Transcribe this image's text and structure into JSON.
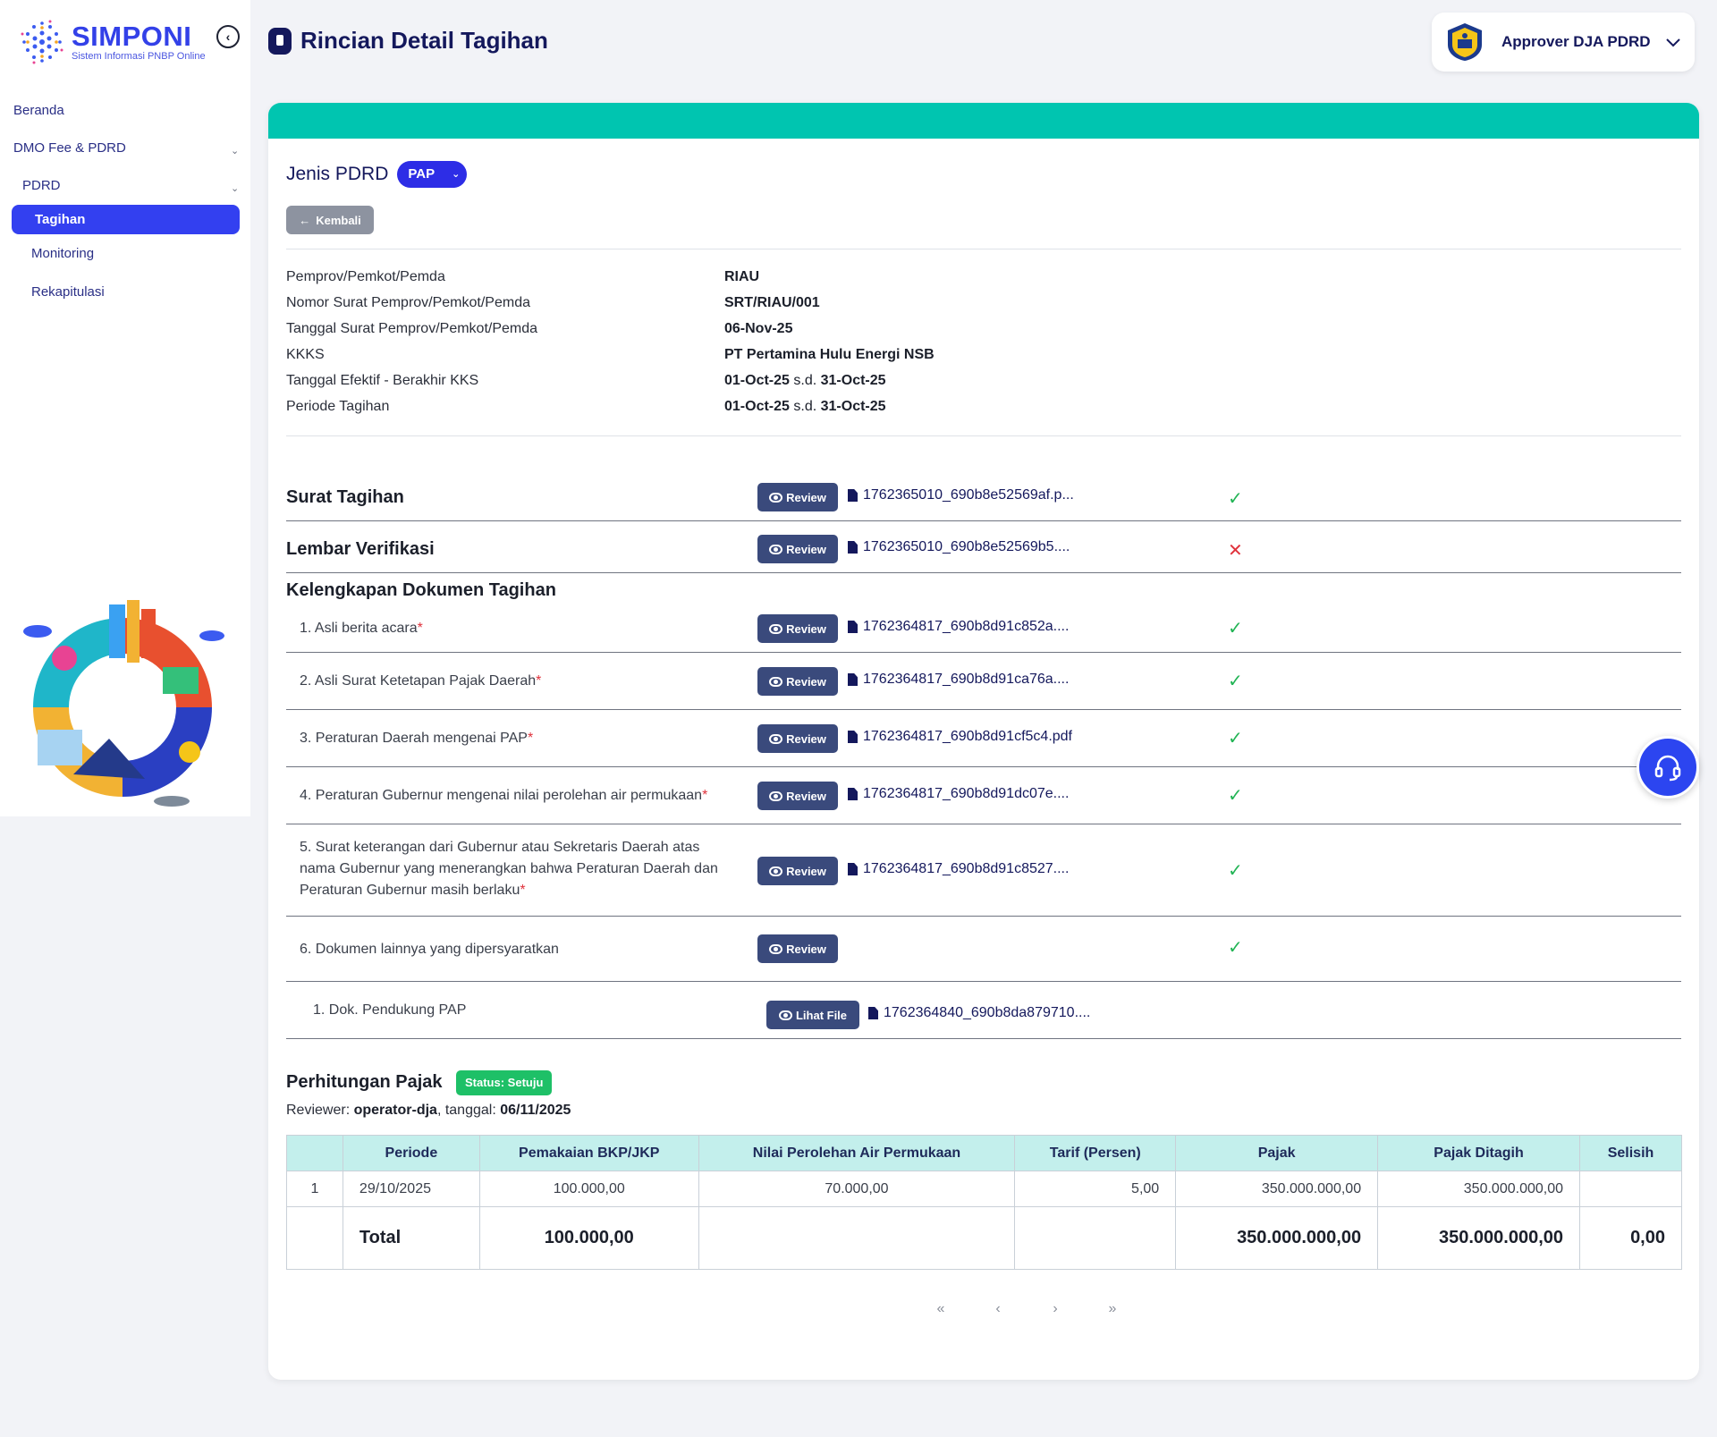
{
  "brand": {
    "title": "SIMPONI",
    "subtitle": "Sistem Informasi PNBP Online",
    "color": "#3341e8"
  },
  "sidebar": {
    "items": [
      {
        "label": "Beranda"
      },
      {
        "label": "DMO Fee & PDRD"
      },
      {
        "label": "PDRD"
      },
      {
        "label": "Tagihan",
        "active": true
      },
      {
        "label": "Monitoring"
      },
      {
        "label": "Rekapitulasi"
      }
    ]
  },
  "header": {
    "title": "Rincian Detail Tagihan",
    "user": "Approver DJA PDRD"
  },
  "card": {
    "accent": "#00c5b0",
    "jenis_label": "Jenis PDRD",
    "jenis_value": "PAP",
    "back_label": "Kembali",
    "info": [
      {
        "label": "Pemprov/Pemkot/Pemda",
        "value": "RIAU"
      },
      {
        "label": "Nomor Surat Pemprov/Pemkot/Pemda",
        "value": "SRT/RIAU/001"
      },
      {
        "label": "Tanggal Surat Pemprov/Pemkot/Pemda",
        "value": "06-Nov-25"
      },
      {
        "label": "KKKS",
        "value": "PT Pertamina Hulu Energi NSB"
      },
      {
        "label": "Tanggal Efektif - Berakhir KKS",
        "from": "01-Oct-25",
        "sep": "s.d.",
        "to": "31-Oct-25"
      },
      {
        "label": "Periode Tagihan",
        "from": "01-Oct-25",
        "sep": "s.d.",
        "to": "31-Oct-25"
      }
    ],
    "review_label": "Review",
    "lihat_label": "Lihat File",
    "surat": {
      "title": "Surat Tagihan",
      "file": "1762365010_690b8e52569af.p...",
      "status": "✓"
    },
    "lembar": {
      "title": "Lembar Verifikasi",
      "file": "1762365010_690b8e52569b5....",
      "status": "✕"
    },
    "kelengkapan_title": "Kelengkapan Dokumen Tagihan",
    "docs": [
      {
        "label": "1. Asli berita acara",
        "req": "*",
        "file": "1762364817_690b8d91c852a....",
        "status": "✓"
      },
      {
        "label": "2. Asli Surat Ketetapan Pajak Daerah",
        "req": "*",
        "file": "1762364817_690b8d91ca76a....",
        "status": "✓"
      },
      {
        "label": "3. Peraturan Daerah mengenai PAP",
        "req": "*",
        "file": "1762364817_690b8d91cf5c4.pdf",
        "status": "✓"
      },
      {
        "label": "4. Peraturan Gubernur mengenai nilai perolehan air permukaan",
        "req": "*",
        "file": "1762364817_690b8d91dc07e....",
        "status": "✓"
      },
      {
        "label_lines": [
          "5. Surat keterangan dari Gubernur atau Sekretaris Daerah atas",
          "nama Gubernur yang menerangkan bahwa Peraturan Daerah dan",
          "Peraturan Gubernur masih berlaku"
        ],
        "req": "*",
        "file": "1762364817_690b8d91c8527....",
        "status": "✓"
      },
      {
        "label": "6. Dokumen lainnya yang dipersyaratkan",
        "status": "✓"
      }
    ],
    "sub_doc": {
      "label": "1. Dok. Pendukung PAP",
      "file": "1762364840_690b8da879710...."
    },
    "perhitungan": {
      "title": "Perhitungan Pajak",
      "status": "Status: Setuju",
      "reviewer_prefix": "Reviewer:",
      "reviewer": "operator-dja",
      "tanggal_prefix": ", tanggal:",
      "tanggal": "06/11/2025",
      "columns": [
        "",
        "Periode",
        "Pemakaian BKP/JKP",
        "Nilai Perolehan Air Permukaan",
        "Tarif (Persen)",
        "Pajak",
        "Pajak Ditagih",
        "Selisih"
      ],
      "rows": [
        [
          "1",
          "29/10/2025",
          "100.000,00",
          "70.000,00",
          "5,00",
          "350.000.000,00",
          "350.000.000,00",
          ""
        ]
      ],
      "total": {
        "label": "Total",
        "pemakaian": "100.000,00",
        "pajak": "350.000.000,00",
        "ditagih": "350.000.000,00",
        "selisih": "0,00"
      }
    },
    "pager": [
      "«",
      "‹",
      "›",
      "»"
    ]
  }
}
